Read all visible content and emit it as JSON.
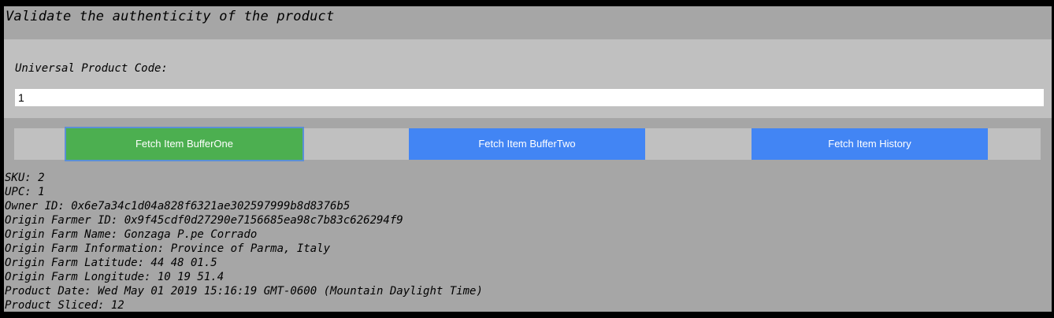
{
  "page": {
    "title": "Validate the authenticity of the product"
  },
  "form": {
    "upc_label": "Universal Product Code:",
    "upc_value": "1"
  },
  "buttons": {
    "buffer_one": "Fetch Item BufferOne",
    "buffer_two": "Fetch Item BufferTwo",
    "history": "Fetch Item History"
  },
  "colors": {
    "active_button": "#4caf50",
    "button": "#4285f4",
    "background": "#a6a6a6",
    "panel": "#c0c0c0"
  },
  "result": [
    "SKU: 2",
    "UPC: 1",
    "Owner ID: 0x6e7a34c1d04a828f6321ae302597999b8d8376b5",
    "Origin Farmer ID: 0x9f45cdf0d27290e7156685ea98c7b83c626294f9",
    "Origin Farm Name: Gonzaga P.pe Corrado",
    "Origin Farm Information: Province of Parma, Italy",
    "Origin Farm Latitude: 44 48 01.5",
    "Origin Farm Longitude: 10 19 51.4",
    "Product Date: Wed May 01 2019 15:16:19 GMT-0600 (Mountain Daylight Time)",
    "Product Sliced: 12"
  ]
}
